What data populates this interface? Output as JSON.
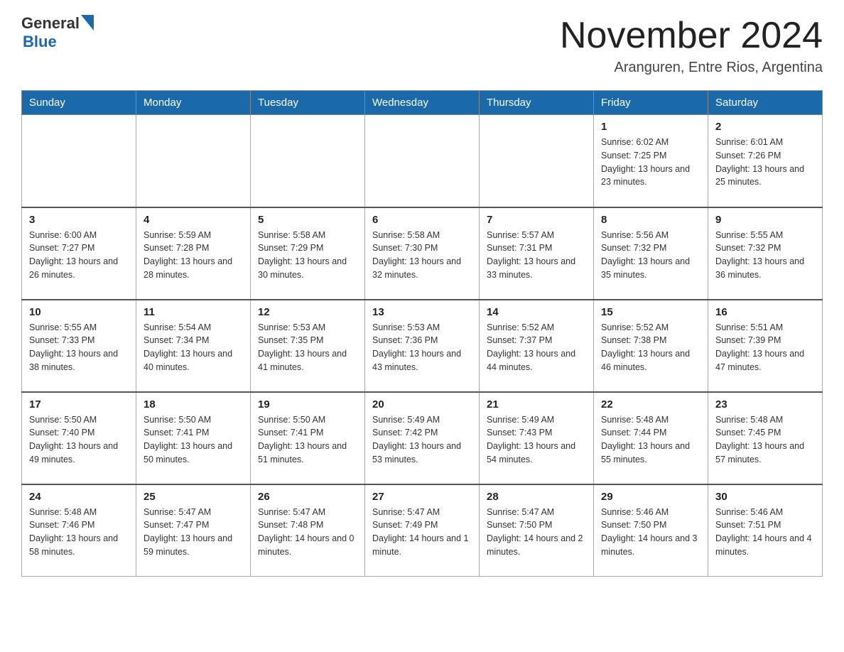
{
  "header": {
    "logo_general": "General",
    "logo_blue": "Blue",
    "month_year": "November 2024",
    "location": "Aranguren, Entre Rios, Argentina"
  },
  "weekdays": [
    "Sunday",
    "Monday",
    "Tuesday",
    "Wednesday",
    "Thursday",
    "Friday",
    "Saturday"
  ],
  "weeks": [
    [
      {
        "day": "",
        "info": ""
      },
      {
        "day": "",
        "info": ""
      },
      {
        "day": "",
        "info": ""
      },
      {
        "day": "",
        "info": ""
      },
      {
        "day": "",
        "info": ""
      },
      {
        "day": "1",
        "info": "Sunrise: 6:02 AM\nSunset: 7:25 PM\nDaylight: 13 hours and 23 minutes."
      },
      {
        "day": "2",
        "info": "Sunrise: 6:01 AM\nSunset: 7:26 PM\nDaylight: 13 hours and 25 minutes."
      }
    ],
    [
      {
        "day": "3",
        "info": "Sunrise: 6:00 AM\nSunset: 7:27 PM\nDaylight: 13 hours and 26 minutes."
      },
      {
        "day": "4",
        "info": "Sunrise: 5:59 AM\nSunset: 7:28 PM\nDaylight: 13 hours and 28 minutes."
      },
      {
        "day": "5",
        "info": "Sunrise: 5:58 AM\nSunset: 7:29 PM\nDaylight: 13 hours and 30 minutes."
      },
      {
        "day": "6",
        "info": "Sunrise: 5:58 AM\nSunset: 7:30 PM\nDaylight: 13 hours and 32 minutes."
      },
      {
        "day": "7",
        "info": "Sunrise: 5:57 AM\nSunset: 7:31 PM\nDaylight: 13 hours and 33 minutes."
      },
      {
        "day": "8",
        "info": "Sunrise: 5:56 AM\nSunset: 7:32 PM\nDaylight: 13 hours and 35 minutes."
      },
      {
        "day": "9",
        "info": "Sunrise: 5:55 AM\nSunset: 7:32 PM\nDaylight: 13 hours and 36 minutes."
      }
    ],
    [
      {
        "day": "10",
        "info": "Sunrise: 5:55 AM\nSunset: 7:33 PM\nDaylight: 13 hours and 38 minutes."
      },
      {
        "day": "11",
        "info": "Sunrise: 5:54 AM\nSunset: 7:34 PM\nDaylight: 13 hours and 40 minutes."
      },
      {
        "day": "12",
        "info": "Sunrise: 5:53 AM\nSunset: 7:35 PM\nDaylight: 13 hours and 41 minutes."
      },
      {
        "day": "13",
        "info": "Sunrise: 5:53 AM\nSunset: 7:36 PM\nDaylight: 13 hours and 43 minutes."
      },
      {
        "day": "14",
        "info": "Sunrise: 5:52 AM\nSunset: 7:37 PM\nDaylight: 13 hours and 44 minutes."
      },
      {
        "day": "15",
        "info": "Sunrise: 5:52 AM\nSunset: 7:38 PM\nDaylight: 13 hours and 46 minutes."
      },
      {
        "day": "16",
        "info": "Sunrise: 5:51 AM\nSunset: 7:39 PM\nDaylight: 13 hours and 47 minutes."
      }
    ],
    [
      {
        "day": "17",
        "info": "Sunrise: 5:50 AM\nSunset: 7:40 PM\nDaylight: 13 hours and 49 minutes."
      },
      {
        "day": "18",
        "info": "Sunrise: 5:50 AM\nSunset: 7:41 PM\nDaylight: 13 hours and 50 minutes."
      },
      {
        "day": "19",
        "info": "Sunrise: 5:50 AM\nSunset: 7:41 PM\nDaylight: 13 hours and 51 minutes."
      },
      {
        "day": "20",
        "info": "Sunrise: 5:49 AM\nSunset: 7:42 PM\nDaylight: 13 hours and 53 minutes."
      },
      {
        "day": "21",
        "info": "Sunrise: 5:49 AM\nSunset: 7:43 PM\nDaylight: 13 hours and 54 minutes."
      },
      {
        "day": "22",
        "info": "Sunrise: 5:48 AM\nSunset: 7:44 PM\nDaylight: 13 hours and 55 minutes."
      },
      {
        "day": "23",
        "info": "Sunrise: 5:48 AM\nSunset: 7:45 PM\nDaylight: 13 hours and 57 minutes."
      }
    ],
    [
      {
        "day": "24",
        "info": "Sunrise: 5:48 AM\nSunset: 7:46 PM\nDaylight: 13 hours and 58 minutes."
      },
      {
        "day": "25",
        "info": "Sunrise: 5:47 AM\nSunset: 7:47 PM\nDaylight: 13 hours and 59 minutes."
      },
      {
        "day": "26",
        "info": "Sunrise: 5:47 AM\nSunset: 7:48 PM\nDaylight: 14 hours and 0 minutes."
      },
      {
        "day": "27",
        "info": "Sunrise: 5:47 AM\nSunset: 7:49 PM\nDaylight: 14 hours and 1 minute."
      },
      {
        "day": "28",
        "info": "Sunrise: 5:47 AM\nSunset: 7:50 PM\nDaylight: 14 hours and 2 minutes."
      },
      {
        "day": "29",
        "info": "Sunrise: 5:46 AM\nSunset: 7:50 PM\nDaylight: 14 hours and 3 minutes."
      },
      {
        "day": "30",
        "info": "Sunrise: 5:46 AM\nSunset: 7:51 PM\nDaylight: 14 hours and 4 minutes."
      }
    ]
  ]
}
